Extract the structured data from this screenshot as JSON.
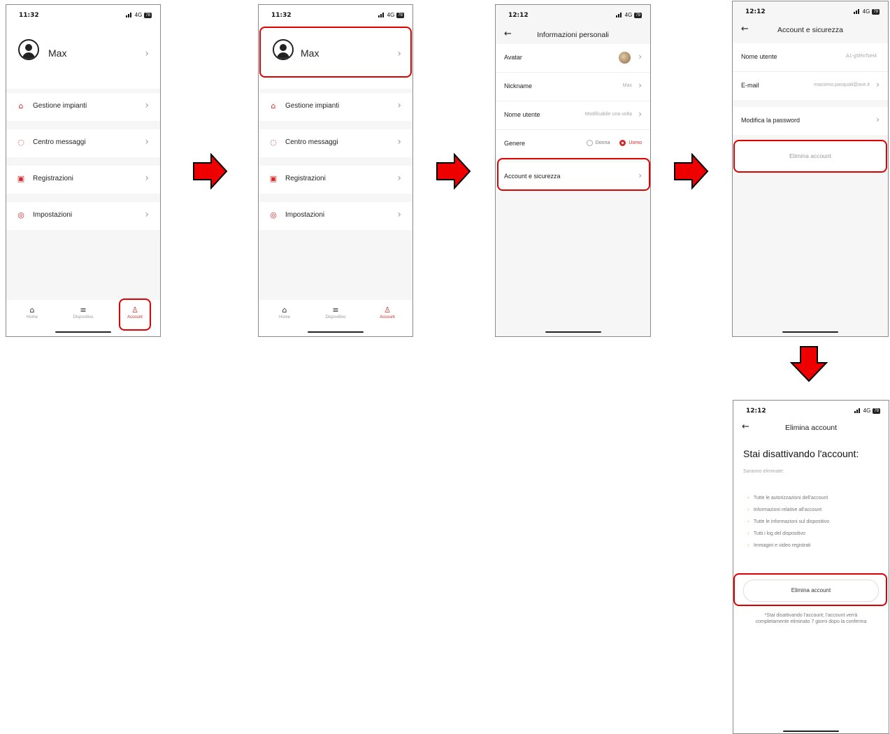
{
  "screen1": {
    "status": {
      "time": "11:32",
      "signal": "4G",
      "battery": "78"
    },
    "profile_name": "Max",
    "menu": [
      {
        "icon": "home-icon",
        "label": "Gestione impianti"
      },
      {
        "icon": "message-icon",
        "label": "Centro messaggi"
      },
      {
        "icon": "record-icon",
        "label": "Registrazioni"
      },
      {
        "icon": "settings-icon",
        "label": "Impostazioni"
      }
    ],
    "tabs": [
      {
        "icon": "home-icon",
        "label": "Home"
      },
      {
        "icon": "device-icon",
        "label": "Dispositivo"
      },
      {
        "icon": "user-icon",
        "label": "Account"
      }
    ]
  },
  "screen3": {
    "status": {
      "time": "12:12",
      "signal": "4G",
      "battery": "79"
    },
    "title": "Informazioni personali",
    "rows": {
      "avatar": "Avatar",
      "nickname": "Nickname",
      "nickname_value": "Max",
      "username": "Nome utente",
      "username_value": "Modificabile una volta",
      "gender": "Genere",
      "gender_female": "Donna",
      "gender_male": "Uomo",
      "security": "Account e sicurezza"
    }
  },
  "screen4": {
    "status": {
      "time": "12:12",
      "signal": "4G",
      "battery": "79"
    },
    "title": "Account e sicurezza",
    "username_label": "Nome utente",
    "username_value": "A1-g5RnToH4",
    "email_label": "E-mail",
    "email_value": "massimo.pasquali@ave.it",
    "password_label": "Modifica la password",
    "delete_label": "Elimina account"
  },
  "screen5": {
    "status": {
      "time": "12:12",
      "signal": "4G",
      "battery": "79"
    },
    "title": "Elimina account",
    "heading": "Stai disattivando l'account:",
    "subheading": "Saranno eliminate:",
    "items": [
      "Tutte le autorizzazioni dell'account",
      "Informazioni relative all'account",
      "Tutte le informazioni sul dispositivo",
      "Tutti i log del dispositivo",
      "Immagini e video registrati"
    ],
    "button": "Elimina account",
    "note_line1": "*Stai disattivando l'account; l'account verrà",
    "note_line2": "completamente eliminato 7 giorni dopo la conferma"
  },
  "colors": {
    "accent": "#d42a2a",
    "highlight": "#e00000",
    "arrow_fill": "#ee0000"
  }
}
